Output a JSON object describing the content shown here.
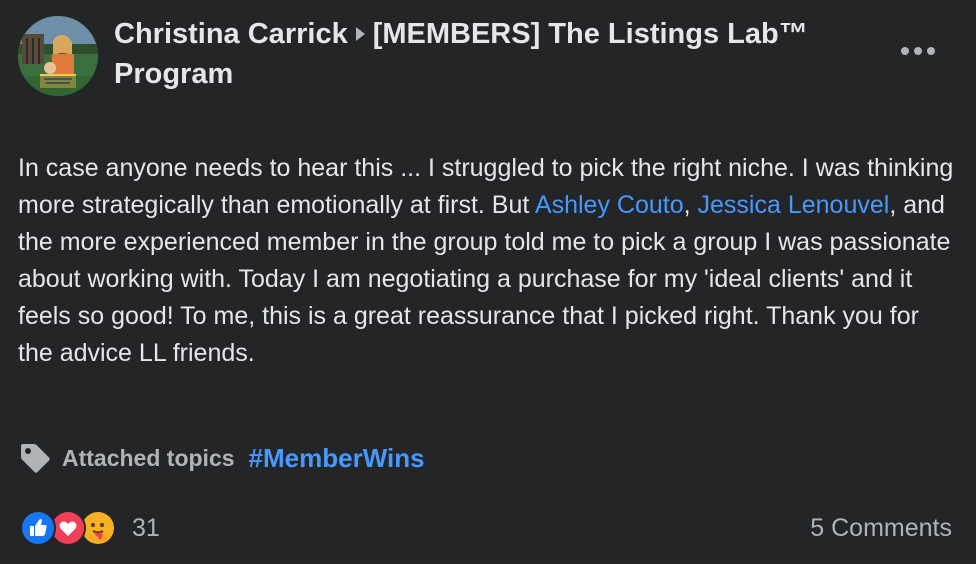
{
  "post": {
    "author": "Christina Carrick",
    "group": "[MEMBERS] The Listings Lab™ Program",
    "more_icon": "more-horizontal-icon",
    "body": {
      "part1": "In case anyone needs to hear this ... I struggled to pick the right niche. I was thinking more strategically than emotionally at first. But ",
      "mention1": "Ashley Couto",
      "sep": ", ",
      "mention2": "Jessica Lenouvel",
      "part2": ", and the more experienced member in the group told me to pick a group I was passionate about working with. Today I am negotiating a purchase for my 'ideal clients' and it feels so good! To me, this is a great reassurance that I picked right. Thank you for the advice LL friends."
    },
    "topics": {
      "icon": "tag-icon",
      "label": "Attached topics",
      "hashtag": "#MemberWins"
    },
    "reactions": {
      "icons": [
        "like-icon",
        "love-icon",
        "care-icon"
      ],
      "count": "31"
    },
    "comments": "5 Comments"
  },
  "colors": {
    "background": "#242526",
    "text": "#e4e6eb",
    "secondary_text": "#b0b3b8",
    "link": "#4599ff"
  }
}
